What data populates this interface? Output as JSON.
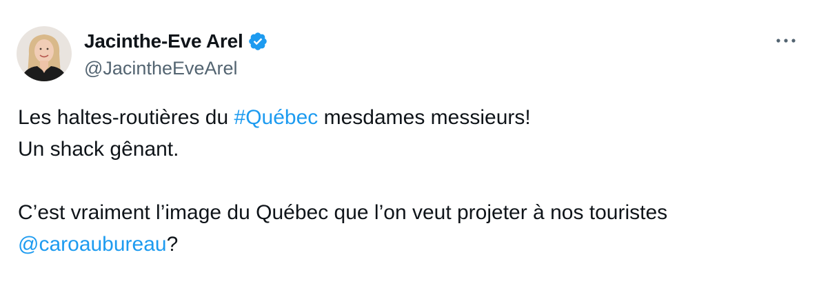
{
  "author": {
    "display_name": "Jacinthe-Eve Arel",
    "handle": "@JacintheEveArel",
    "verified": true,
    "avatar": "profile-photo"
  },
  "colors": {
    "text": "#0f1419",
    "secondary": "#536471",
    "link": "#1d9bf0",
    "verified_badge": "#1d9bf0"
  },
  "icons": {
    "verified": "verified-badge-icon",
    "more": "more-horizontal-icon"
  },
  "tweet": {
    "line1_before": "Les haltes-routières du ",
    "line1_hashtag": "#Québec",
    "line1_after": " mesdames messieurs!",
    "line2": "Un shack gênant.",
    "line3": "C’est vraiment l’image du Québec que l’on veut projeter à nos touristes",
    "line4_mention": "@caroaubureau",
    "line4_after": "?"
  }
}
